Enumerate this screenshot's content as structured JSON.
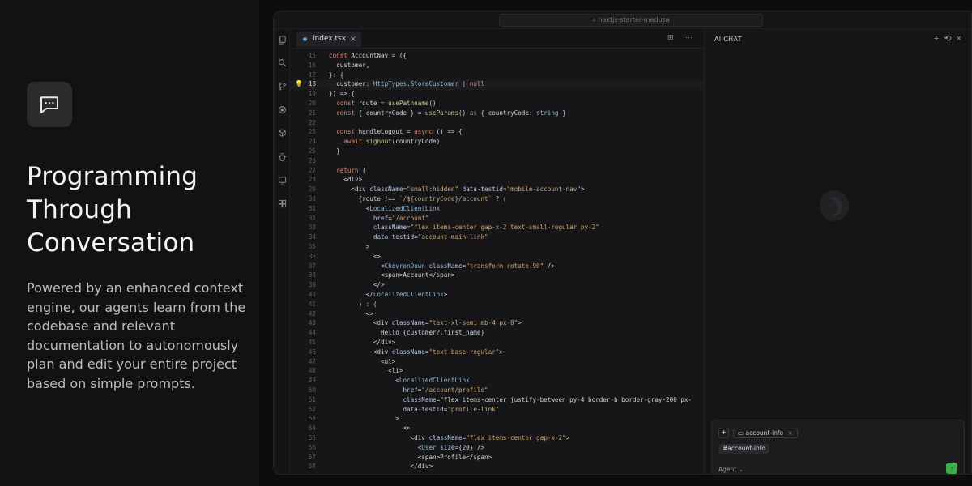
{
  "hero": {
    "title_lines": [
      "Programming",
      "Through",
      "Conversation"
    ],
    "description": "Powered by an enhanced context engine, our agents learn from the codebase and relevant documentation to autonomously plan and edit your entire project based on simple prompts."
  },
  "window": {
    "search_text": "nextjs-starter-medusa"
  },
  "editor": {
    "tab_label": "index.tsx",
    "tab_close": "×",
    "tools": "⊞ ⋯",
    "active_line": 18
  },
  "chat": {
    "title": "AI CHAT",
    "tool_add": "+",
    "tool_history": "⟲",
    "tool_close": "×",
    "composer": {
      "plus": "+",
      "context_chip": "account-info",
      "context_chip_close": "×",
      "mention": "#account-info",
      "mode": "Agent",
      "mode_caret": "⌄",
      "send": "↑"
    }
  },
  "colors": {
    "accent_green": "#3fae4a",
    "background": "#0b0b0b",
    "left_panel": "#121213"
  },
  "icons": [
    "message-square-icon",
    "files-icon",
    "search-icon",
    "source-control-icon",
    "run-debug-icon",
    "extensions-icon",
    "bug-icon",
    "remote-icon",
    "grid-icon"
  ],
  "code_lines": [
    {
      "n": "15",
      "text": "const AccountNav = ({"
    },
    {
      "n": "16",
      "text": "  customer,"
    },
    {
      "n": "17",
      "text": "}: {"
    },
    {
      "n": "18",
      "text": "  customer: HttpTypes.StoreCustomer | null"
    },
    {
      "n": "19",
      "text": "}) => {"
    },
    {
      "n": "20",
      "text": "  const route = usePathname()"
    },
    {
      "n": "21",
      "text": "  const { countryCode } = useParams() as { countryCode: string }"
    },
    {
      "n": "22",
      "text": ""
    },
    {
      "n": "23",
      "text": "  const handleLogout = async () => {"
    },
    {
      "n": "24",
      "text": "    await signout(countryCode)"
    },
    {
      "n": "25",
      "text": "  }"
    },
    {
      "n": "26",
      "text": ""
    },
    {
      "n": "27",
      "text": "  return ("
    },
    {
      "n": "28",
      "text": "    <div>"
    },
    {
      "n": "29",
      "text": "      <div className=\"small:hidden\" data-testid=\"mobile-account-nav\">"
    },
    {
      "n": "30",
      "text": "        {route !== `/${countryCode}/account` ? ("
    },
    {
      "n": "31",
      "text": "          <LocalizedClientLink"
    },
    {
      "n": "32",
      "text": "            href=\"/account\""
    },
    {
      "n": "33",
      "text": "            className=\"flex items-center gap-x-2 text-small-regular py-2\""
    },
    {
      "n": "34",
      "text": "            data-testid=\"account-main-link\""
    },
    {
      "n": "35",
      "text": "          >"
    },
    {
      "n": "36",
      "text": "            <>"
    },
    {
      "n": "37",
      "text": "              <ChevronDown className=\"transform rotate-90\" />"
    },
    {
      "n": "38",
      "text": "              <span>Account</span>"
    },
    {
      "n": "39",
      "text": "            </>"
    },
    {
      "n": "40",
      "text": "          </LocalizedClientLink>"
    },
    {
      "n": "41",
      "text": "        ) : ("
    },
    {
      "n": "42",
      "text": "          <>"
    },
    {
      "n": "43",
      "text": "            <div className=\"text-xl-semi mb-4 px-8\">"
    },
    {
      "n": "44",
      "text": "              Hello {customer?.first_name}"
    },
    {
      "n": "45",
      "text": "            </div>"
    },
    {
      "n": "46",
      "text": "            <div className=\"text-base-regular\">"
    },
    {
      "n": "47",
      "text": "              <ul>"
    },
    {
      "n": "48",
      "text": "                <li>"
    },
    {
      "n": "49",
      "text": "                  <LocalizedClientLink"
    },
    {
      "n": "50",
      "text": "                    href=\"/account/profile\""
    },
    {
      "n": "51",
      "text": "                    className=\"flex items-center justify-between py-4 border-b border-gray-200 px-"
    },
    {
      "n": "52",
      "text": "                    data-testid=\"profile-link\""
    },
    {
      "n": "53",
      "text": "                  >"
    },
    {
      "n": "54",
      "text": "                    <>"
    },
    {
      "n": "55",
      "text": "                      <div className=\"flex items-center gap-x-2\">"
    },
    {
      "n": "56",
      "text": "                        <User size={20} />"
    },
    {
      "n": "57",
      "text": "                        <span>Profile</span>"
    },
    {
      "n": "58",
      "text": "                      </div>"
    }
  ]
}
